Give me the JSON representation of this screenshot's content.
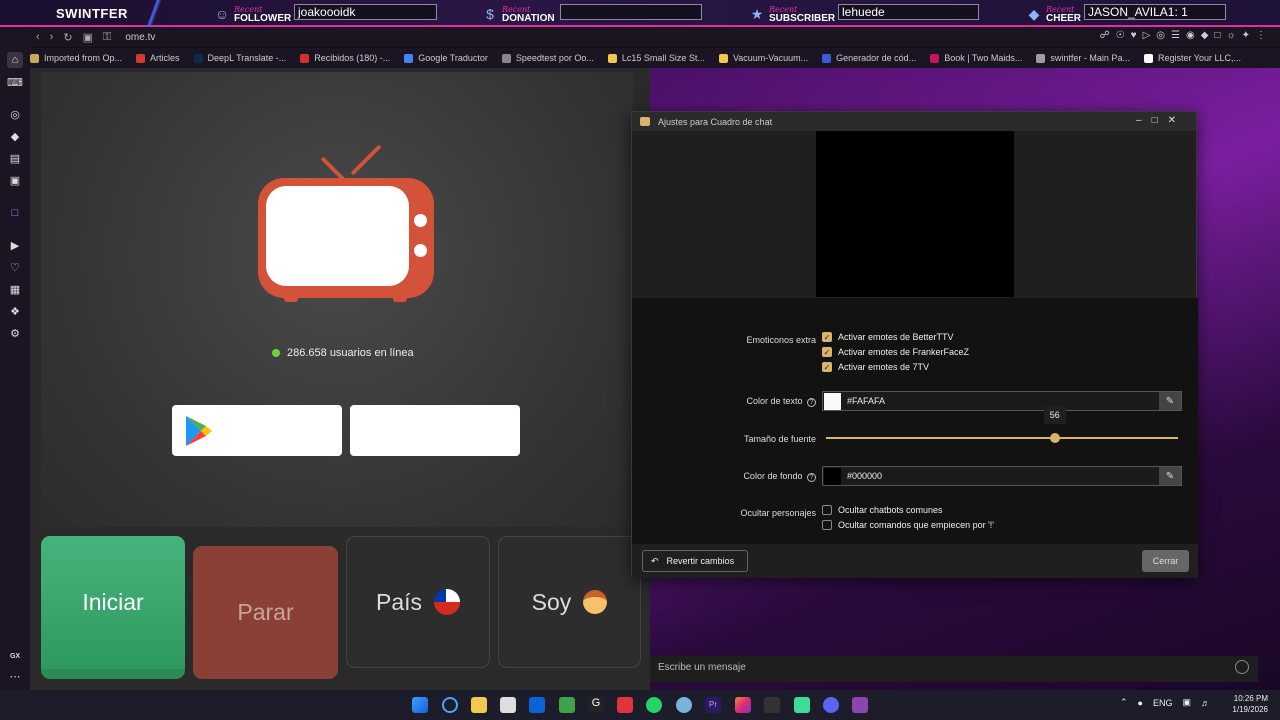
{
  "overlay": {
    "brand": "SWINTFER",
    "recent_word": "Recent",
    "follower": {
      "kind": "FOLLOWER",
      "value": "joakoooidk"
    },
    "donation": {
      "kind": "DONATION",
      "value": ""
    },
    "subscriber": {
      "kind": "SUBSCRIBER",
      "value": "lehuede"
    },
    "cheer": {
      "kind": "CHEER",
      "value": "JASON_AVILA1: 1"
    }
  },
  "browser": {
    "url": "ome.tv",
    "bookmarks": [
      {
        "label": "Imported from Op...",
        "color": "#c9a95a"
      },
      {
        "label": "Articles",
        "color": "#d23b2b"
      },
      {
        "label": "DeepL Translate -...",
        "color": "#0f2b46"
      },
      {
        "label": "Recibidos (180) -...",
        "color": "#d93025"
      },
      {
        "label": "Google Traductor",
        "color": "#4285f4"
      },
      {
        "label": "Speedtest por Oo...",
        "color": "#888888"
      },
      {
        "label": "Lc15 Small Size St...",
        "color": "#f2c94c"
      },
      {
        "label": "Vacuum-Vacuum...",
        "color": "#f2c94c"
      },
      {
        "label": "Generador de cód...",
        "color": "#3b5bdb"
      },
      {
        "label": "Book | Two Maids...",
        "color": "#c2185b"
      },
      {
        "label": "swintfer - Main Pa...",
        "color": "#9e9e9e"
      },
      {
        "label": "Register Your LLC,...",
        "color": "#ffffff"
      }
    ],
    "sidebar_bottom_label": "GX"
  },
  "ome": {
    "online_text": "286.658 usuarios en línea",
    "buttons": {
      "start": "Iniciar",
      "stop": "Parar",
      "country": "País",
      "gender": "Soy"
    }
  },
  "chat": {
    "placeholder": "Escribe un mensaje"
  },
  "dialog": {
    "title": "Ajustes para Cuadro de chat",
    "extra_emotes_label": "Emoticonos extra",
    "emotes": [
      {
        "label": "Activar emotes de BetterTTV",
        "checked": true
      },
      {
        "label": "Activar emotes de FrankerFaceZ",
        "checked": true
      },
      {
        "label": "Activar emotes de 7TV",
        "checked": true
      }
    ],
    "text_color_label": "Color de texto",
    "text_color_value": "#FAFAFA",
    "font_size_label": "Tamaño de fuente",
    "font_size_value": "56",
    "font_size_fraction": 0.65,
    "bg_color_label": "Color de fondo",
    "bg_color_value": "#000000",
    "hide_users_label": "Ocultar personajes",
    "hide_options": [
      {
        "label": "Ocultar chatbots comunes",
        "checked": false
      },
      {
        "label": "Ocultar comandos que empiecen por '!'",
        "checked": false
      }
    ],
    "revert_label": "Revertir cambios",
    "close_label": "Cerrar"
  },
  "taskbar": {
    "lang": "ENG",
    "time": "10:26 PM",
    "date": "1/19/2026"
  },
  "colors": {
    "accent_gold": "#d9b56b",
    "tv_red": "#d4513a",
    "start_green": "#3aa56b",
    "stop_red": "#8a4035"
  }
}
